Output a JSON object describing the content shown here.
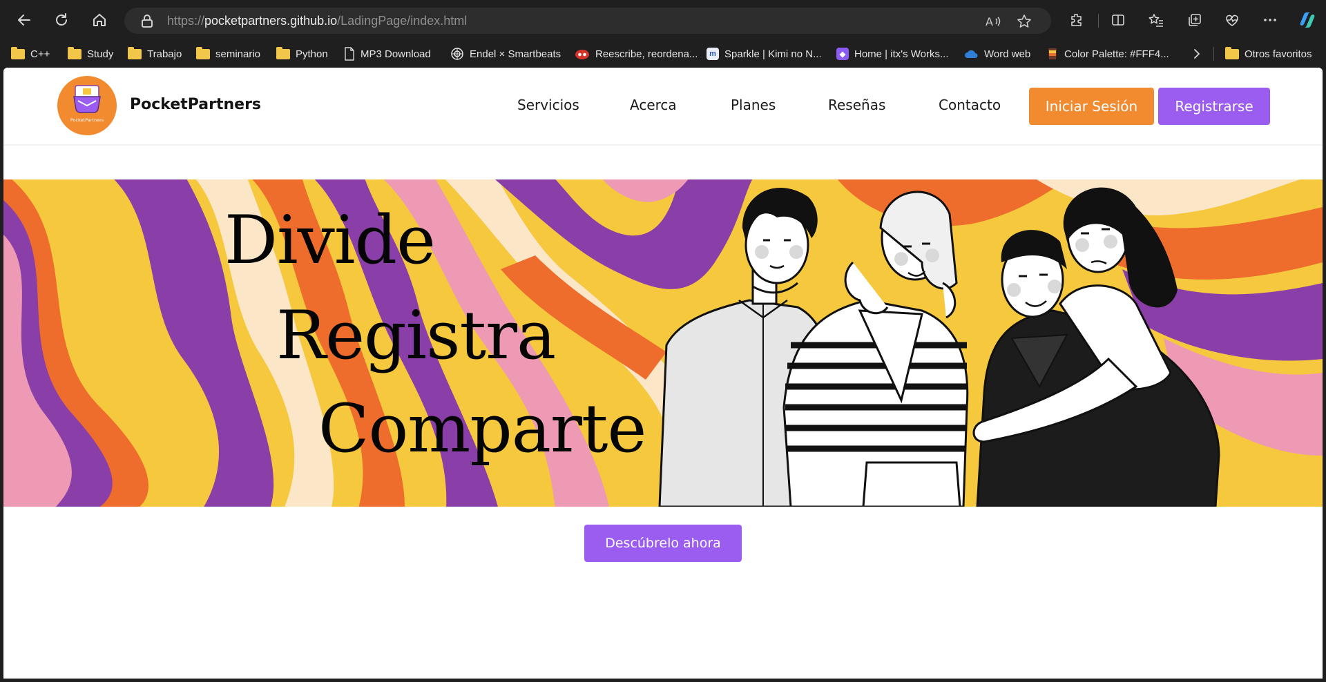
{
  "browser": {
    "url_scheme": "https://",
    "url_host": "pocketpartners.github.io",
    "url_path": "/LadingPage/index.html"
  },
  "bookmarks": [
    {
      "label": "C++",
      "type": "folder"
    },
    {
      "label": "Study",
      "type": "folder"
    },
    {
      "label": "Trabajo",
      "type": "folder"
    },
    {
      "label": "seminario",
      "type": "folder"
    },
    {
      "label": "Python",
      "type": "folder"
    },
    {
      "label": "MP3 Download",
      "type": "page"
    },
    {
      "label": "Endel × Smartbeats",
      "type": "site"
    },
    {
      "label": "Reescribe, reordena...",
      "type": "site"
    },
    {
      "label": "Sparkle | Kimi no N...",
      "type": "site"
    },
    {
      "label": "Home | itx's Works...",
      "type": "site"
    },
    {
      "label": "Word web",
      "type": "site"
    },
    {
      "label": "Color Palette: #FFF4...",
      "type": "site"
    },
    {
      "label": "Otros favoritos",
      "type": "folder"
    }
  ],
  "site": {
    "logo_mark_text": "PocketPartners",
    "brand": "PocketPartners",
    "nav": [
      "Servicios",
      "Acerca",
      "Planes",
      "Reseñas",
      "Contacto"
    ],
    "login_label": "Iniciar Sesión",
    "signup_label": "Registrarse",
    "hero_words": [
      "Divide",
      "Registra",
      "Comparte"
    ],
    "cta_label": "Descúbrelo ahora"
  },
  "colors": {
    "orange": "#f28a2f",
    "purple": "#9b5cf0",
    "hero_purple": "#8a3ea8",
    "hero_yellow": "#f5c83e",
    "hero_pink": "#ee9ab4",
    "hero_cream": "#fbe6c8",
    "hero_orange": "#ee6d2c"
  },
  "icons": [
    "back-icon",
    "reload-icon",
    "home-icon",
    "lock-icon",
    "read-aloud-icon",
    "favorite-star-icon",
    "extensions-icon",
    "split-screen-icon",
    "favorites-icon",
    "collections-icon",
    "health-icon",
    "more-icon",
    "copilot-icon"
  ]
}
